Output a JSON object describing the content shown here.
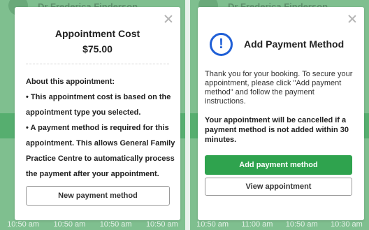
{
  "background": {
    "doctor_name": "Dr Frederica Finderson",
    "times_left": [
      "10:50 am",
      "10:50 am",
      "10:50 am",
      "10:50 am"
    ],
    "times_right": [
      "10:50 am",
      "11:00 am",
      "10:50 am",
      "10:30 am"
    ]
  },
  "cost_modal": {
    "title": "Appointment Cost",
    "amount": "$75.00",
    "about_heading": "About this appointment:",
    "lines": [
      "•  This appointment cost is based on the",
      "appointment type you selected.",
      "•  A payment method is required for this",
      "appointment. This allows General Family",
      "Practice Centre to automatically process",
      "the payment after your appointment."
    ],
    "button_label": "New payment method"
  },
  "payment_modal": {
    "icon": "exclamation-circle-icon",
    "title": "Add Payment Method",
    "description": "Thank you for your booking. To secure your appointment, please click \"Add payment method\" and follow the payment instructions.",
    "warning": "Your appointment will be cancelled if a payment method is not added within 30 minutes.",
    "primary_button_label": "Add payment method",
    "secondary_button_label": "View appointment"
  },
  "colors": {
    "accent_green": "#2fa34e",
    "info_blue": "#1f5fd6",
    "overlay_green": "#7fbf8f"
  }
}
